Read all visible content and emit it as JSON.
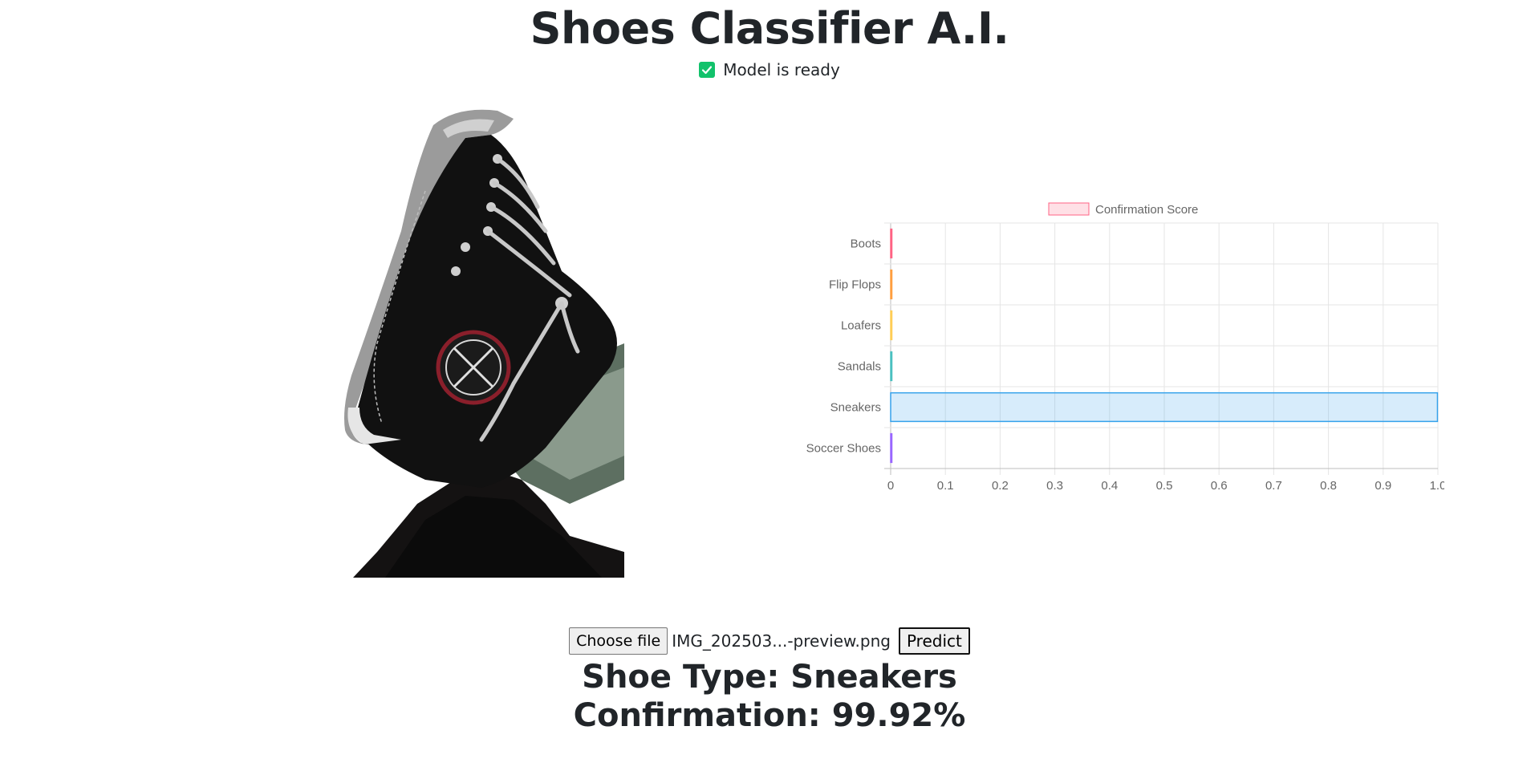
{
  "header": {
    "title": "Shoes Classifier A.I."
  },
  "status": {
    "text": "Model is ready",
    "icon": "check-icon",
    "color": "#12c26b"
  },
  "upload": {
    "choose_label": "Choose file",
    "file_name": "IMG_202503...-preview.png",
    "predict_label": "Predict"
  },
  "result": {
    "type_line": "Shoe Type: Sneakers",
    "confirmation_line": "Confirmation: 99.92%"
  },
  "image": {
    "subject": "black high-top sneaker"
  },
  "chart_data": {
    "type": "bar",
    "orientation": "horizontal",
    "categories": [
      "Boots",
      "Flip Flops",
      "Loafers",
      "Sandals",
      "Sneakers",
      "Soccer Shoes"
    ],
    "series": [
      {
        "name": "Confirmation Score",
        "values": [
          0.0,
          0.0003,
          0.0002,
          0.0001,
          0.9992,
          0.0002
        ]
      }
    ],
    "xlim": [
      0,
      1.0
    ],
    "xticks": [
      "0",
      "0.1",
      "0.2",
      "0.3",
      "0.4",
      "0.5",
      "0.6",
      "0.7",
      "0.8",
      "0.9",
      "1.0"
    ],
    "grid": true,
    "legend_position": "top",
    "legend_color": "#ff6384",
    "bar_colors": [
      "#ff6384",
      "#ff9f40",
      "#ffcd56",
      "#4bc0c0",
      "#36a2eb",
      "#9966ff"
    ]
  }
}
